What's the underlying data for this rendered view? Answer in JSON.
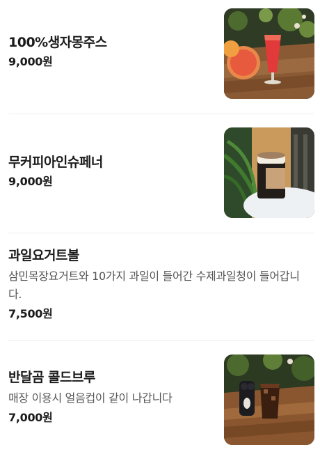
{
  "menu": {
    "items": [
      {
        "name": "100%생자몽주스",
        "description": "",
        "price": "9,000원",
        "image": "grapefruit-juice-photo"
      },
      {
        "name": "무커피아인슈페너",
        "description": "",
        "price": "9,000원",
        "image": "einspanner-drink-photo"
      },
      {
        "name": "과일요거트볼",
        "description": "삼민목장요거트와 10가지 과일이 들어간 수제과일청이 들어갑니다.",
        "price": "7,500원",
        "image": ""
      },
      {
        "name": "반달곰 콜드브루",
        "description": "매장 이용시 얼음컵이 같이 나갑니다",
        "price": "7,000원",
        "image": "cold-brew-photo"
      }
    ]
  }
}
